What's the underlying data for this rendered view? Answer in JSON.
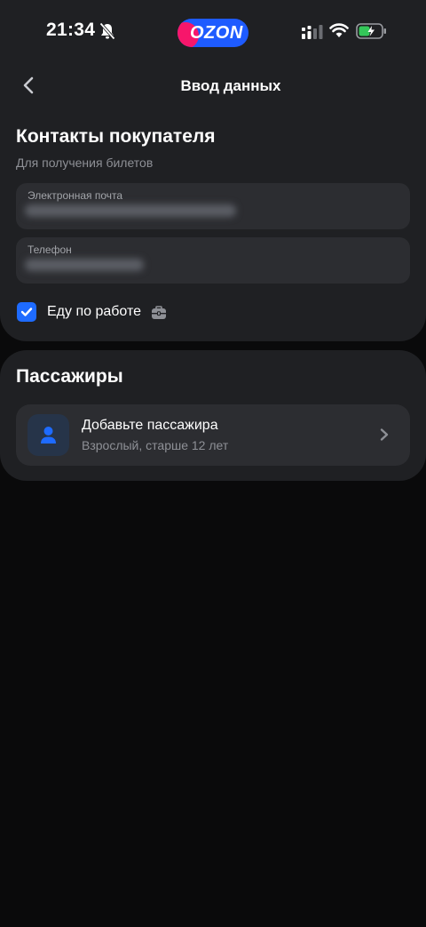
{
  "status_bar": {
    "time": "21:34",
    "logo_text": "OZON"
  },
  "header": {
    "title": "Ввод данных"
  },
  "contacts": {
    "title": "Контакты покупателя",
    "subtitle": "Для получения билетов",
    "email_label": "Электронная почта",
    "phone_label": "Телефон",
    "checkbox_label": "Еду по работе",
    "checkbox_checked": true
  },
  "passengers": {
    "title": "Пассажиры",
    "add_title": "Добавьте пассажира",
    "add_subtitle": "Взрослый, старше 12 лет"
  },
  "icons": {
    "bell": "bell-slash-icon",
    "signal": "signal-icon",
    "wifi": "wifi-icon",
    "battery": "battery-charging-icon",
    "back": "chevron-left-icon",
    "briefcase": "briefcase-icon",
    "person": "person-icon",
    "chevron": "chevron-right-icon"
  },
  "colors": {
    "accent": "#1e6bff",
    "logo_blue": "#1e5bff",
    "logo_pink": "#f7166b",
    "battery_green": "#34c759"
  }
}
